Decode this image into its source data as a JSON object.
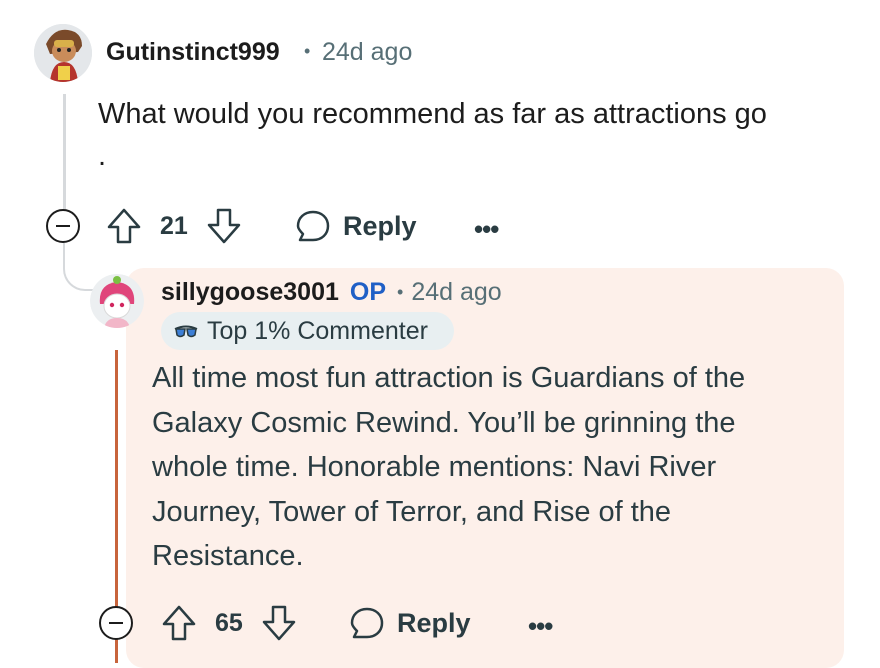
{
  "comment": {
    "username": "Gutinstinct999",
    "separator": "•",
    "time": "24d ago",
    "body_line1": "What would you recommend as far as attractions go",
    "body_line2": ".",
    "upvotes": "21",
    "reply_label": "Reply",
    "more_label": "•••"
  },
  "reply": {
    "username": "sillygoose3001",
    "op_label": "OP",
    "separator": "•",
    "time": "24d ago",
    "badge_label": "Top 1% Commenter",
    "body_lines": [
      "All time most fun attraction is Guardians of the",
      "Galaxy Cosmic Rewind. You’ll be grinning the",
      "whole time. Honorable mentions: Navi River",
      "Journey, Tower of Terror, and Rise of the",
      "Resistance."
    ],
    "upvotes": "65",
    "reply_label": "Reply",
    "more_label": "•••"
  },
  "icons": {
    "upvote": "upvote-arrow-icon",
    "downvote": "downvote-arrow-icon",
    "reply": "speech-bubble-icon",
    "collapse": "collapse-minus-icon",
    "badge": "sunglasses-icon"
  },
  "colors": {
    "reply_background": "#fdf0ea",
    "op": "#1f5fc6",
    "badge_background": "#e8eff1",
    "reply_thread_line": "#c8643c"
  }
}
